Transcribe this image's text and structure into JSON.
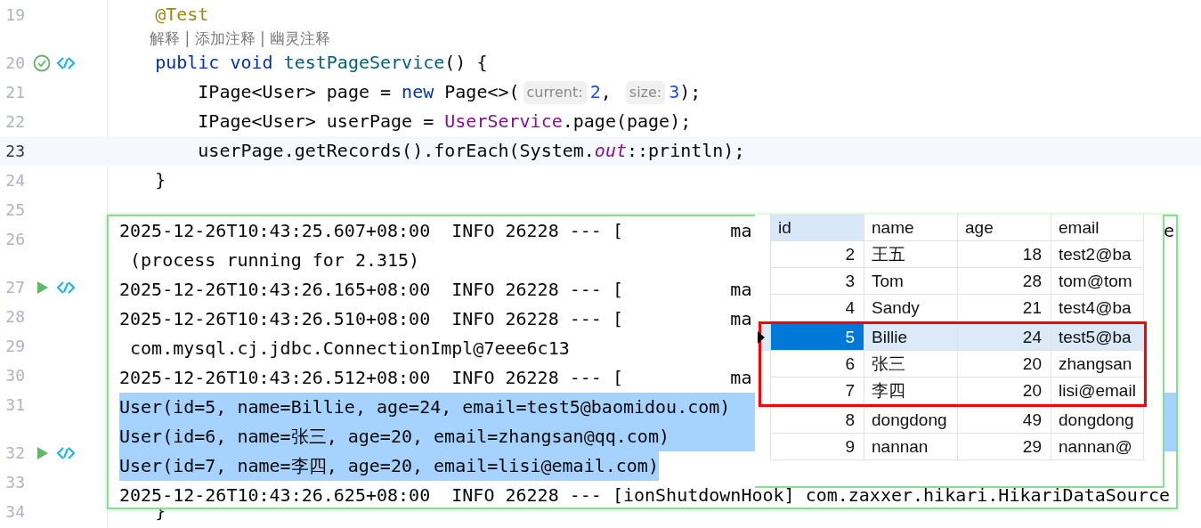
{
  "editor": {
    "lines": [
      {
        "number": "19",
        "current": false,
        "tokens": [
          {
            "text": "    @Test",
            "kind": "annotation"
          }
        ]
      },
      {
        "number": "20",
        "icons": [
          {
            "kind": "check"
          },
          {
            "kind": "link"
          }
        ],
        "current": false,
        "hint": "解释 | 添加注释 | 幽灵注释",
        "tokens": [
          {
            "text": "    public void ",
            "kind": "keyword"
          },
          {
            "text": "testPageService",
            "kind": "method"
          },
          {
            "text": "() {",
            "kind": "plain"
          }
        ]
      },
      {
        "number": "21",
        "current": false,
        "tokens": [
          {
            "text": "        IPage<User> page = ",
            "kind": "plain"
          },
          {
            "text": "new",
            "kind": "keyword"
          },
          {
            "text": " Page<>(",
            "kind": "plain"
          },
          {
            "text": "current:",
            "kind": "inlay"
          },
          {
            "text": "2",
            "kind": "number"
          },
          {
            "text": ", ",
            "kind": "plain"
          },
          {
            "text": "size:",
            "kind": "inlay"
          },
          {
            "text": "3",
            "kind": "number"
          },
          {
            "text": ");",
            "kind": "plain"
          }
        ]
      },
      {
        "number": "22",
        "current": false,
        "tokens": [
          {
            "text": "        IPage<User> userPage = ",
            "kind": "plain"
          },
          {
            "text": "UserService",
            "kind": "class"
          },
          {
            "text": ".page(page);",
            "kind": "plain"
          }
        ]
      },
      {
        "number": "23",
        "current": true,
        "tokens": [
          {
            "text": "        userPage.getRecords().forEach(System.",
            "kind": "plain"
          },
          {
            "text": "out",
            "kind": "static"
          },
          {
            "text": "::println);",
            "kind": "plain"
          }
        ]
      },
      {
        "number": "24",
        "current": false,
        "tokens": [
          {
            "text": "    }",
            "kind": "plain"
          }
        ]
      },
      {
        "number": "25",
        "current": false
      },
      {
        "number": "26",
        "current": false
      },
      {
        "number": "27",
        "icons": [
          {
            "kind": "run"
          },
          {
            "kind": "link"
          }
        ],
        "current": false
      },
      {
        "number": "28",
        "current": false
      },
      {
        "number": "29",
        "current": false
      },
      {
        "number": "30",
        "current": false
      },
      {
        "number": "31",
        "current": false
      },
      {
        "number": "32",
        "icons": [
          {
            "kind": "run"
          },
          {
            "kind": "link"
          }
        ],
        "current": false
      },
      {
        "number": "33",
        "current": false
      },
      {
        "number": "34",
        "current": false,
        "tokens": [
          {
            "text": "    }",
            "kind": "plain"
          }
        ]
      }
    ]
  },
  "console": {
    "lines": [
      {
        "text": "2025-12-26T10:43:25.607+08:00  INFO 26228 --- [          ma",
        "tail": "e",
        "selected": false
      },
      {
        "text": " (process running for 2.315)",
        "selected": false
      },
      {
        "text": "2025-12-26T10:43:26.165+08:00  INFO 26228 --- [          ma",
        "selected": false
      },
      {
        "text": "2025-12-26T10:43:26.510+08:00  INFO 26228 --- [          ma",
        "selected": false
      },
      {
        "text": " com.mysql.cj.jdbc.ConnectionImpl@7eee6c13",
        "selected": false
      },
      {
        "text": "2025-12-26T10:43:26.512+08:00  INFO 26228 --- [          ma",
        "selected": false
      },
      {
        "text": "User(id=5, name=Billie, age=24, email=test5@baomidou.com)",
        "selected": true
      },
      {
        "text": "User(id=6, name=张三, age=20, email=zhangsan@qq.com)",
        "selected": true
      },
      {
        "text": "User(id=7, name=李四, age=20, email=lisi@email.com)",
        "selected": true
      },
      {
        "text": "2025-12-26T10:43:26.625+08:00  INFO 26228 --- [ionShutdownHook] com.zaxxer.hikari.HikariDataSource",
        "selected": false
      }
    ]
  },
  "result_grid": {
    "columns": [
      {
        "label": "id",
        "kind": "number",
        "selected": true
      },
      {
        "label": "name",
        "kind": "text",
        "selected": false
      },
      {
        "label": "age",
        "kind": "number",
        "selected": false
      },
      {
        "label": "email",
        "kind": "text",
        "selected": false
      }
    ],
    "rows": [
      {
        "cells": [
          "2",
          "王五",
          "18",
          "test2@ba"
        ],
        "selected": false,
        "marked": false
      },
      {
        "cells": [
          "3",
          "Tom",
          "28",
          "tom@tom"
        ],
        "selected": false,
        "marked": false
      },
      {
        "cells": [
          "4",
          "Sandy",
          "21",
          "test4@ba"
        ],
        "selected": false,
        "marked": false
      },
      {
        "cells": [
          "5",
          "Billie",
          "24",
          "test5@ba"
        ],
        "selected": true,
        "marked": true
      },
      {
        "cells": [
          "6",
          "张三",
          "20",
          "zhangsan"
        ],
        "selected": false,
        "marked": true
      },
      {
        "cells": [
          "7",
          "李四",
          "20",
          "lisi@email"
        ],
        "selected": false,
        "marked": true
      },
      {
        "cells": [
          "8",
          "dongdong",
          "49",
          "dongdong"
        ],
        "selected": false,
        "marked": false
      },
      {
        "cells": [
          "9",
          "nannan",
          "29",
          "nannan@"
        ],
        "selected": false,
        "marked": false
      }
    ]
  }
}
